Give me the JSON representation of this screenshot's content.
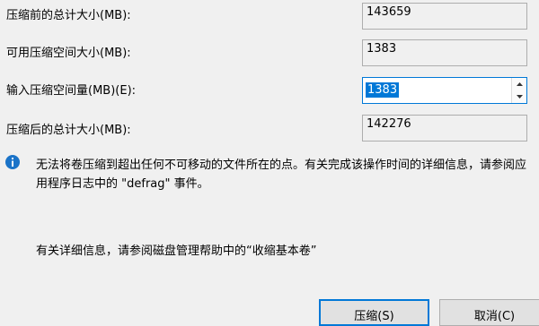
{
  "fields": {
    "total_before_label": "压缩前的总计大小(MB):",
    "total_before_value": "143659",
    "available_label": "可用压缩空间大小(MB):",
    "available_value": "1383",
    "shrink_amount_label": "输入压缩空间量(MB)(E):",
    "shrink_amount_value": "1383",
    "total_after_label": "压缩后的总计大小(MB):",
    "total_after_value": "142276"
  },
  "info": {
    "icon": "info-icon",
    "message": "无法将卷压缩到超出任何不可移动的文件所在的点。有关完成该操作时间的详细信息，请参阅应用程序日志中的 \"defrag\" 事件。"
  },
  "help": {
    "text": "有关详细信息，请参阅磁盘管理帮助中的“收缩基本卷”"
  },
  "buttons": {
    "shrink_label": "压缩(S)",
    "cancel_label": "取消(C)"
  },
  "colors": {
    "accent": "#0078d7",
    "info_icon": "#1a73c8"
  }
}
